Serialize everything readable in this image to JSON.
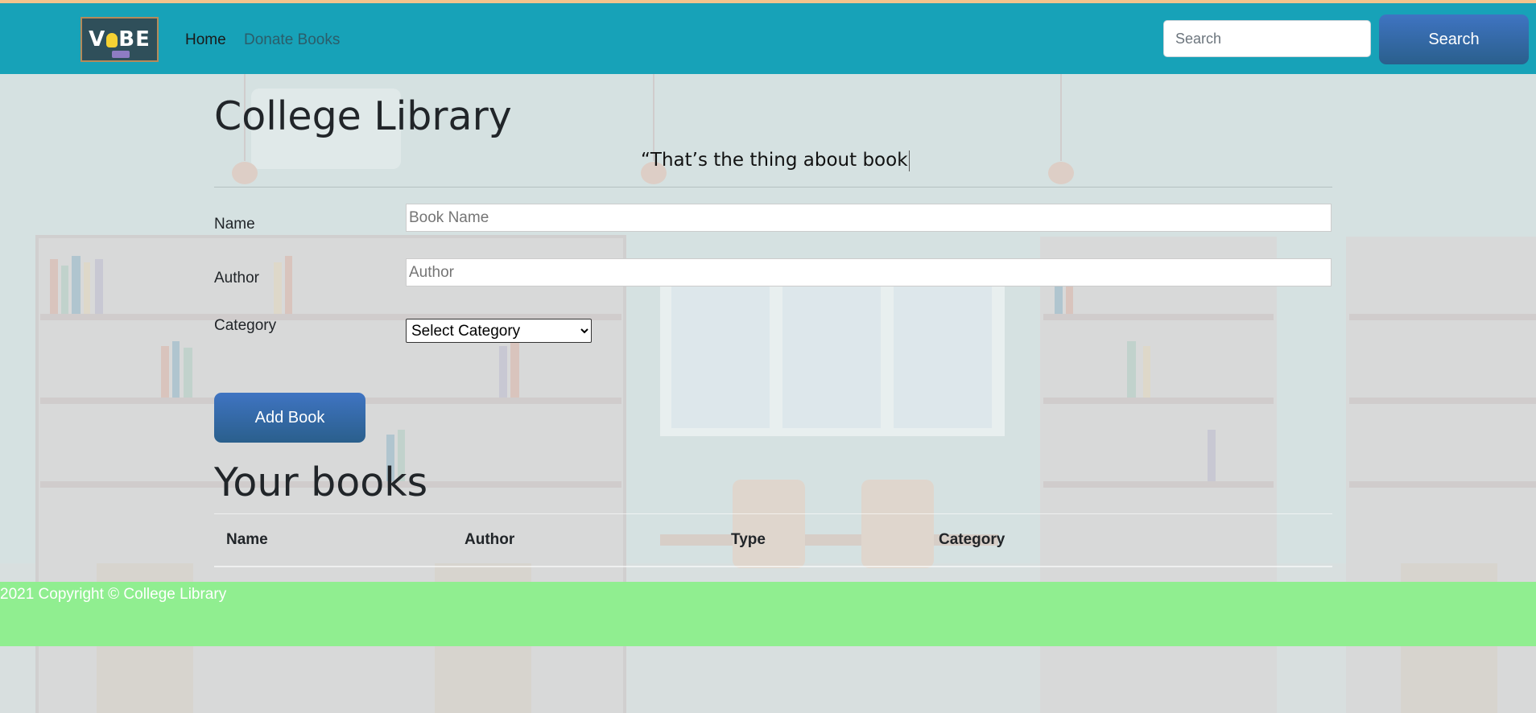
{
  "brand": {
    "logo_text": "VIBE"
  },
  "nav": {
    "home_label": "Home",
    "donate_label": "Donate Books",
    "search_placeholder": "Search",
    "search_value": "",
    "search_button_label": "Search"
  },
  "main": {
    "title": "College Library",
    "quote": "“That’s the thing about book",
    "form": {
      "name_label": "Name",
      "name_placeholder": "Book Name",
      "name_value": "",
      "author_label": "Author",
      "author_placeholder": "Author",
      "author_value": "",
      "category_label": "Category",
      "category_selected": "Select Category",
      "submit_label": "Add Book"
    },
    "books_section": {
      "title": "Your books",
      "columns": [
        "Name",
        "Author",
        "Type",
        "Category"
      ],
      "rows": []
    }
  },
  "footer": {
    "text": "2021 Copyright © College Library"
  },
  "colors": {
    "navbar": "#17a2b8",
    "button": "#2a5f8c",
    "footer": "#90ee90",
    "page_background": "#d9e3e3"
  }
}
